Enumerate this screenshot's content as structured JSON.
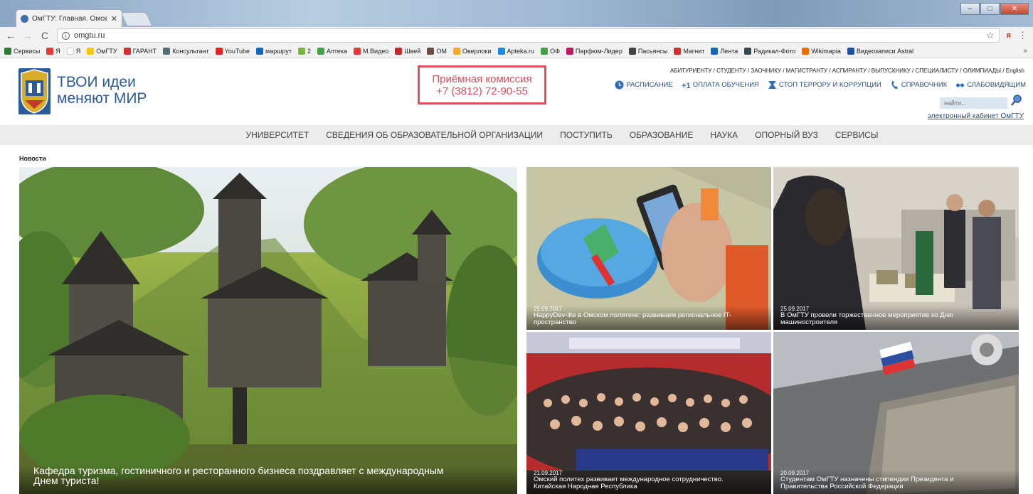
{
  "browser": {
    "tab_title": "ОмГТУ: Главная. Омский",
    "url": "omgtu.ru",
    "bookmarks": [
      {
        "label": "Сервисы",
        "color": "#2e7d32"
      },
      {
        "label": "Я",
        "color": "#e53935"
      },
      {
        "label": "Я",
        "color": "#ffffff"
      },
      {
        "label": "ОмГТУ",
        "color": "#f9c800"
      },
      {
        "label": "ГАРАНТ",
        "color": "#d32f2f"
      },
      {
        "label": "Консультант",
        "color": "#546e7a"
      },
      {
        "label": "YouTube",
        "color": "#e62117"
      },
      {
        "label": "маршрут",
        "color": "#1565c0"
      },
      {
        "label": "2",
        "color": "#7cb342"
      },
      {
        "label": "Аптека",
        "color": "#43a047"
      },
      {
        "label": "М.Видео",
        "color": "#e53935"
      },
      {
        "label": "Швей",
        "color": "#c62828"
      },
      {
        "label": "ОМ",
        "color": "#6d4c41"
      },
      {
        "label": "Оверлоки",
        "color": "#f9a825"
      },
      {
        "label": "Apteka.ru",
        "color": "#1e88e5"
      },
      {
        "label": "ОФ",
        "color": "#43a047"
      },
      {
        "label": "Парфюм-Лидер",
        "color": "#c2185b"
      },
      {
        "label": "Пасьянсы",
        "color": "#424242"
      },
      {
        "label": "Магнит",
        "color": "#d32f2f"
      },
      {
        "label": "Лента",
        "color": "#1565c0"
      },
      {
        "label": "Радикал-Фото",
        "color": "#37474f"
      },
      {
        "label": "Wikimapia",
        "color": "#ef6c00"
      },
      {
        "label": "Видеозаписи Astral",
        "color": "#1e4fa3"
      }
    ],
    "more": "»"
  },
  "header": {
    "slogan_line1": "ТВОИ идеи",
    "slogan_line2": "меняют МИР",
    "admission_label": "Приёмная комиссия",
    "admission_phone": "+7 (3812) 72-90-55",
    "topnav": "АБИТУРИЕНТУ / СТУДЕНТУ / ЗАОЧНИКУ / МАГИСТРАНТУ / АСПИРАНТУ / ВЫПУСКНИКУ / СПЕЦИАЛИСТУ / ОЛИМПИАДЫ / English",
    "quicklinks": [
      "РАСПИСАНИЕ",
      "ОПЛАТА ОБУЧЕНИЯ",
      "СТОП ТЕРРОРУ И КОРРУПЦИИ",
      "СПРАВОЧНИК",
      "СЛАБОВИДЯЩИМ"
    ],
    "search_placeholder": "найти...",
    "cabinet": "электронный кабинет ОмГТУ"
  },
  "menu": [
    "УНИВЕРСИТЕТ",
    "СВЕДЕНИЯ ОБ ОБРАЗОВАТЕЛЬНОЙ ОРГАНИЗАЦИИ",
    "ПОСТУПИТЬ",
    "ОБРАЗОВАНИЕ",
    "НАУКА",
    "ОПОРНЫЙ ВУЗ",
    "СЕРВИСЫ"
  ],
  "news": {
    "heading": "Новости",
    "featured": {
      "title_line1": "Кафедра туризма, гостиничного и ресторанного бизнеса поздравляет с международным",
      "title_line2": "Днем туриста!"
    },
    "items": [
      {
        "date": "25.09.2017",
        "title_line1": "HappyDev-lite в Омском политехе: развиваем региональное IT-",
        "title_line2": "пространство"
      },
      {
        "date": "25.09.2017",
        "title_line1": "В ОмГТУ провели торжественное мероприятие ко Дню",
        "title_line2": "машиностроителя"
      },
      {
        "date": "21.09.2017",
        "title_line1": "Омский политех развивает международное сотрудничество.",
        "title_line2": "Китайская Народная Республика"
      },
      {
        "date": "20.09.2017",
        "title_line1": "Студентам ОмГТУ назначены стипендии Президента и",
        "title_line2": "Правительства Российской Федерации"
      }
    ]
  }
}
